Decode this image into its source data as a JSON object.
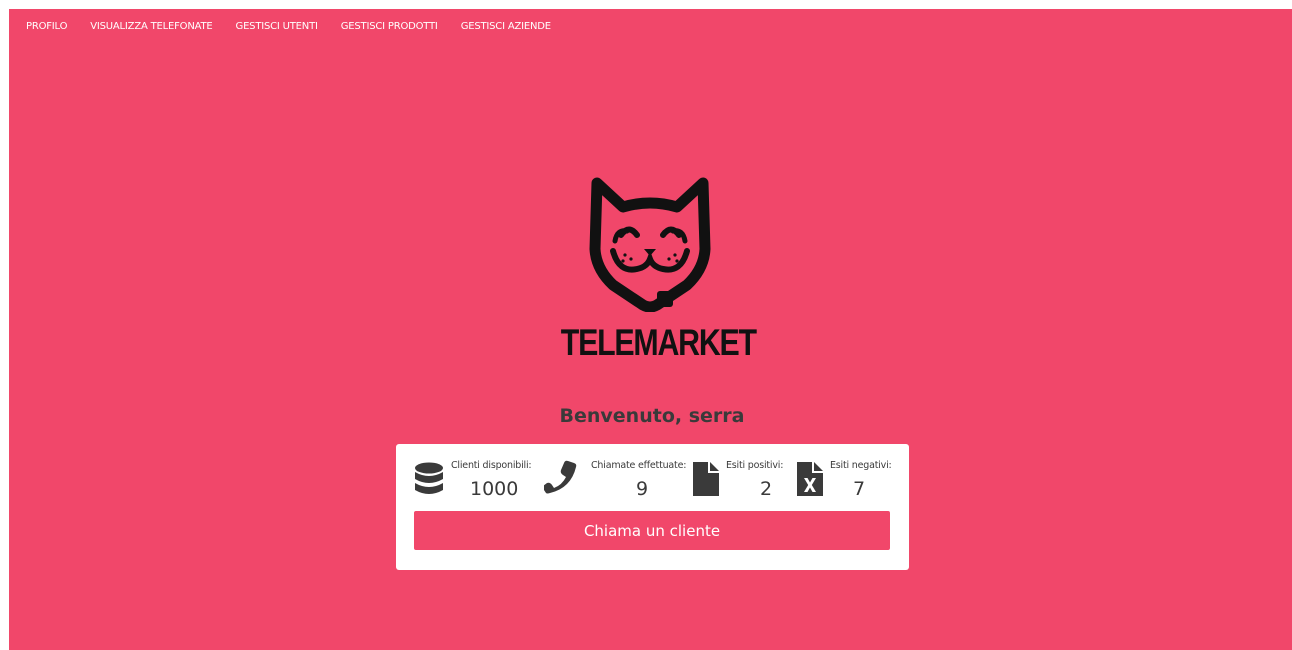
{
  "nav": {
    "items": [
      {
        "label": "PROFILO"
      },
      {
        "label": "VISUALIZZA TELEFONATE"
      },
      {
        "label": "GESTISCI UTENTI"
      },
      {
        "label": "GESTISCI PRODOTTI"
      },
      {
        "label": "GESTISCI AZIENDE"
      }
    ]
  },
  "brand": {
    "name": "TELEMARKET",
    "logo_icon": "cat-face-icon"
  },
  "welcome": "Benvenuto, serra",
  "stats": {
    "clients": {
      "label": "Clienti disponibili:",
      "value": "1000",
      "icon": "database-icon"
    },
    "calls": {
      "label": "Chiamate effettuate:",
      "value": "9",
      "icon": "phone-icon"
    },
    "positive": {
      "label": "Esiti positivi:",
      "value": "2",
      "icon": "file-icon"
    },
    "negative": {
      "label": "Esiti negativi:",
      "value": "7",
      "icon": "file-excel-icon"
    }
  },
  "call_button": "Chiama un cliente",
  "colors": {
    "accent": "#f1476a",
    "card": "#ffffff",
    "text": "#3a3a3a"
  }
}
